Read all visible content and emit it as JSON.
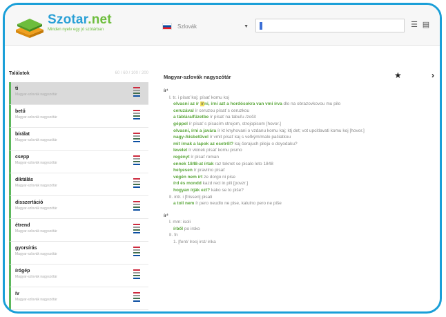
{
  "header": {
    "brand": "Szotar",
    "brand_dot": ".net",
    "tagline": "Minden nyelv egy jó szótárban",
    "language": "Szlovák",
    "search_value": ""
  },
  "sidebar": {
    "title": "Találatok",
    "count": "60 / 60 / 100 / 200",
    "items": [
      {
        "word": "ti",
        "sub": "Magyar-szlovák nagyszótár"
      },
      {
        "word": "betű",
        "sub": "Magyar-szlovák nagyszótár"
      },
      {
        "word": "bírálat",
        "sub": "Magyar-szlovák nagyszótár"
      },
      {
        "word": "csepp",
        "sub": "Magyar-szlovák nagyszótár"
      },
      {
        "word": "diktálás",
        "sub": "Magyar-szlovák nagyszótár"
      },
      {
        "word": "disszertáció",
        "sub": "Magyar-szlovák nagyszótár"
      },
      {
        "word": "étrend",
        "sub": "Magyar-szlovák nagyszótár"
      },
      {
        "word": "gyorsírás",
        "sub": "Magyar-szlovák nagyszótár"
      },
      {
        "word": "írógép",
        "sub": "Magyar-szlovák nagyszótár"
      },
      {
        "word": "ív",
        "sub": "Magyar-szlovák nagyszótár"
      }
    ]
  },
  "main": {
    "title": "Magyar-szlovák nagyszótár",
    "entry1_head": "ír¹",
    "entry2_head": "ír²",
    "lines": [
      {
        "t": "I. tr. i písať koj; písať komu koj",
        "c": "head-line"
      },
      {
        "g": "olvasni az ír",
        "hl": "ír",
        "t": "ni, írni azt a hordósokra van vmi írva",
        "r": " dlo na obrazovkovou mu pilo"
      },
      {
        "g": "ceruzával",
        "t": " ír ceruzou písať s ceruzkou"
      },
      {
        "g": "a táblára/füzetbe",
        "t": " ír písať na tabuľu /zošit"
      },
      {
        "g": "géppel",
        "t": " ír písať s písacím strojom, strojopisom [hovor.]"
      },
      {
        "g": "olvasni, írni a javára",
        "t": " ír kt knyhovani o vzdanu komu kaj; ktj det; vot upcitlavati komu koj [hovor.]"
      },
      {
        "g": "nagy-/kisbetűvel",
        "t": " ír vmit písať kaj s veľkým/malo pačiatkou"
      },
      {
        "g": "mit írnak a lapok az esetről?",
        "t": " kaj čerajuch pileju o doyodaku?"
      },
      {
        "g": "levelet",
        "t": " ír vkinek písať komu pismo"
      },
      {
        "g": "regényt",
        "t": " ír písať roman"
      },
      {
        "g": "ennek 1848-at írtak",
        "t": " raz teknet se pisalo leto 1848"
      },
      {
        "g": "helyesen",
        "t": " ír pravilno písať"
      },
      {
        "g": "végén nem írt",
        "t": " ze dorgo ni pise"
      },
      {
        "g": "írd és mondd",
        "t": " kazd reci in pili [povzr.]"
      },
      {
        "g": "hogyan írják ezt?",
        "t": " kako se to piše?"
      },
      {
        "t": "II. intr. i [frissen] pisati"
      },
      {
        "g": "a toll nem",
        "t": " ír pero neudlo ne pise, kalulno pero ne piše"
      }
    ],
    "lines2": [
      {
        "t": "I. mm: isoli"
      },
      {
        "g": "írből",
        "t": " po irsko"
      },
      {
        "t": "II. fn"
      },
      {
        "t": "1. [fent/ Irecj irst/ irika"
      }
    ]
  }
}
